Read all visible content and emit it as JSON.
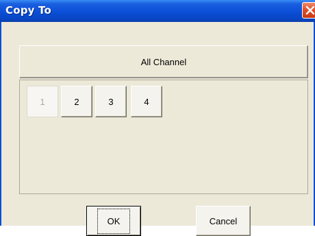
{
  "window": {
    "title": "Copy To",
    "title_color": "#0A4ED8"
  },
  "all_channel": {
    "label": "All Channel"
  },
  "channels": [
    {
      "label": "1",
      "enabled": false
    },
    {
      "label": "2",
      "enabled": true
    },
    {
      "label": "3",
      "enabled": true
    },
    {
      "label": "4",
      "enabled": true
    }
  ],
  "buttons": {
    "ok_label": "OK",
    "cancel_label": "Cancel"
  },
  "icons": {
    "close": "close-icon"
  }
}
